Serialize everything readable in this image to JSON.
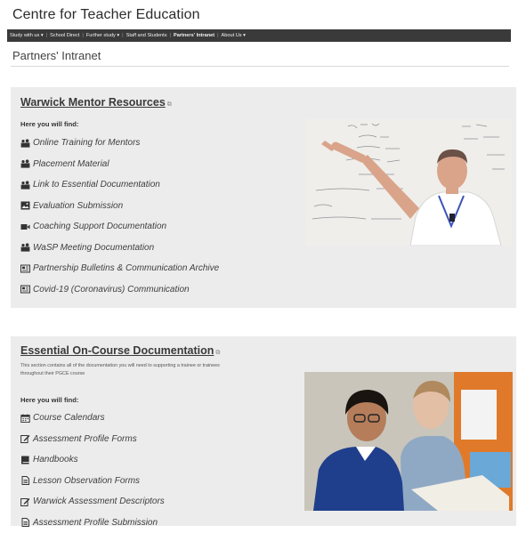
{
  "site": {
    "title": "Centre for Teacher Education"
  },
  "nav": {
    "items": [
      {
        "label": "Study with us ▾",
        "active": false
      },
      {
        "label": "School Direct",
        "active": false
      },
      {
        "label": "Further study ▾",
        "active": false
      },
      {
        "label": "Staff and Students",
        "active": false
      },
      {
        "label": "Partners' Intranet",
        "active": true
      },
      {
        "label": "About Us ▾",
        "active": false
      }
    ]
  },
  "page": {
    "title": "Partners' Intranet"
  },
  "sections": [
    {
      "title": "Warwick Mentor Resources",
      "here_label": "Here you will find:",
      "items": [
        {
          "label": "Online Training for Mentors",
          "icon": "users-icon"
        },
        {
          "label": "Placement Material",
          "icon": "users-icon"
        },
        {
          "label": "Link to Essential Documentation",
          "icon": "users-icon"
        },
        {
          "label": "Evaluation Submission",
          "icon": "image-icon"
        },
        {
          "label": "Coaching Support Documentation",
          "icon": "video-icon"
        },
        {
          "label": "WaSP Meeting Documentation",
          "icon": "users-icon"
        },
        {
          "label": "Partnership Bulletins & Communication Archive",
          "icon": "newspaper-icon"
        },
        {
          "label": "Covid-19 (Coronavirus) Communication",
          "icon": "newspaper-icon"
        }
      ]
    },
    {
      "title": "Essential On-Course Documentation",
      "intro": "This section contains all of the documentation you will need to supporting a trainee or trainees throughout their PGCE course",
      "here_label": "Here you will find:",
      "items": [
        {
          "label": "Course Calendars",
          "icon": "calendar-icon"
        },
        {
          "label": "Assessment Profile Forms",
          "icon": "edit-icon"
        },
        {
          "label": "Handbooks",
          "icon": "book-icon"
        },
        {
          "label": "Lesson Observation Forms",
          "icon": "file-text-icon"
        },
        {
          "label": "Warwick Assessment Descriptors",
          "icon": "edit-icon"
        },
        {
          "label": "Assessment Profile Submission",
          "icon": "file-text-icon"
        }
      ]
    }
  ],
  "colors": {
    "nav_bg": "#3a3a3a",
    "panel_bg": "#ececec",
    "text": "#3e3e3e"
  }
}
